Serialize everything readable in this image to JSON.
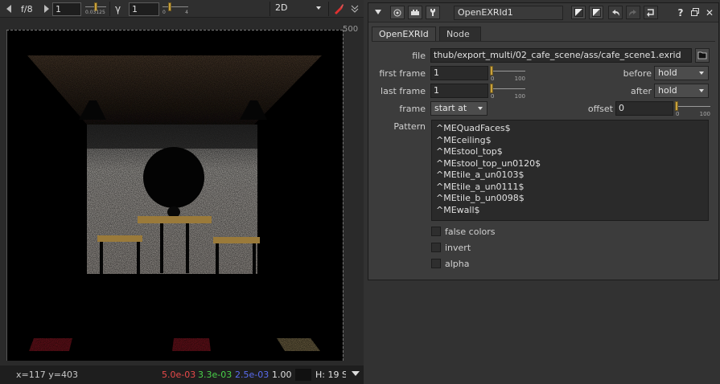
{
  "viewer": {
    "toolbar": {
      "fstop_label": "f/8",
      "frame_value": "1",
      "slider_min": "0.03125",
      "gamma_label": "γ",
      "gamma_value": "1",
      "gamma_slider_min": "0",
      "gamma_slider_max": "4",
      "view_mode": "2D",
      "brush_icon": "paint-brush-icon",
      "menu_icon": "double-chevron-down-icon"
    },
    "format_label": "500",
    "status": {
      "coords": "x=117 y=403",
      "r": "5.0e-03",
      "g": "3.3e-03",
      "b": "2.5e-03",
      "a": "1.00",
      "h": "H: 19 S",
      "colors": {
        "r": "#e84a4a",
        "g": "#4ad24a",
        "b": "#5a6cf0",
        "a": "#e0e0e0"
      }
    }
  },
  "properties": {
    "node_name": "OpenEXRId1",
    "tabs": [
      {
        "label": "OpenEXRId",
        "active": true
      },
      {
        "label": "Node",
        "active": false
      }
    ],
    "header_buttons": [
      "collapse-icon",
      "viewer-icon",
      "node-icon",
      "wrench-icon",
      "color-icon",
      "edit-color-icon",
      "undo-icon",
      "redo-icon",
      "revert-icon",
      "help-icon",
      "float-icon",
      "close-icon"
    ],
    "help_label": "?",
    "close_label": "✕",
    "file": {
      "label": "file",
      "value": "thub/export_multi/02_cafe_scene/ass/cafe_scene1.exrid"
    },
    "first_frame": {
      "label": "first frame",
      "value": "1",
      "min": "0",
      "max": "100"
    },
    "last_frame": {
      "label": "last frame",
      "value": "1",
      "min": "0",
      "max": "100"
    },
    "before": {
      "label": "before",
      "value": "hold"
    },
    "after": {
      "label": "after",
      "value": "hold"
    },
    "frame": {
      "label": "frame",
      "value": "start at"
    },
    "offset": {
      "label": "offset",
      "value": "0",
      "min": "0",
      "max": "100"
    },
    "pattern": {
      "label": "Pattern",
      "lines": [
        "^MEQuadFaces$",
        "^MEceiling$",
        "^MEstool_top$",
        "^MEstool_top_un0120$",
        "^MEtile_a_un0103$",
        "^MEtile_a_un0111$",
        "^MEtile_b_un0098$",
        "^MEwall$"
      ]
    },
    "checkboxes": [
      {
        "label": "false colors",
        "checked": false
      },
      {
        "label": "invert",
        "checked": false
      },
      {
        "label": "alpha",
        "checked": false
      }
    ]
  }
}
